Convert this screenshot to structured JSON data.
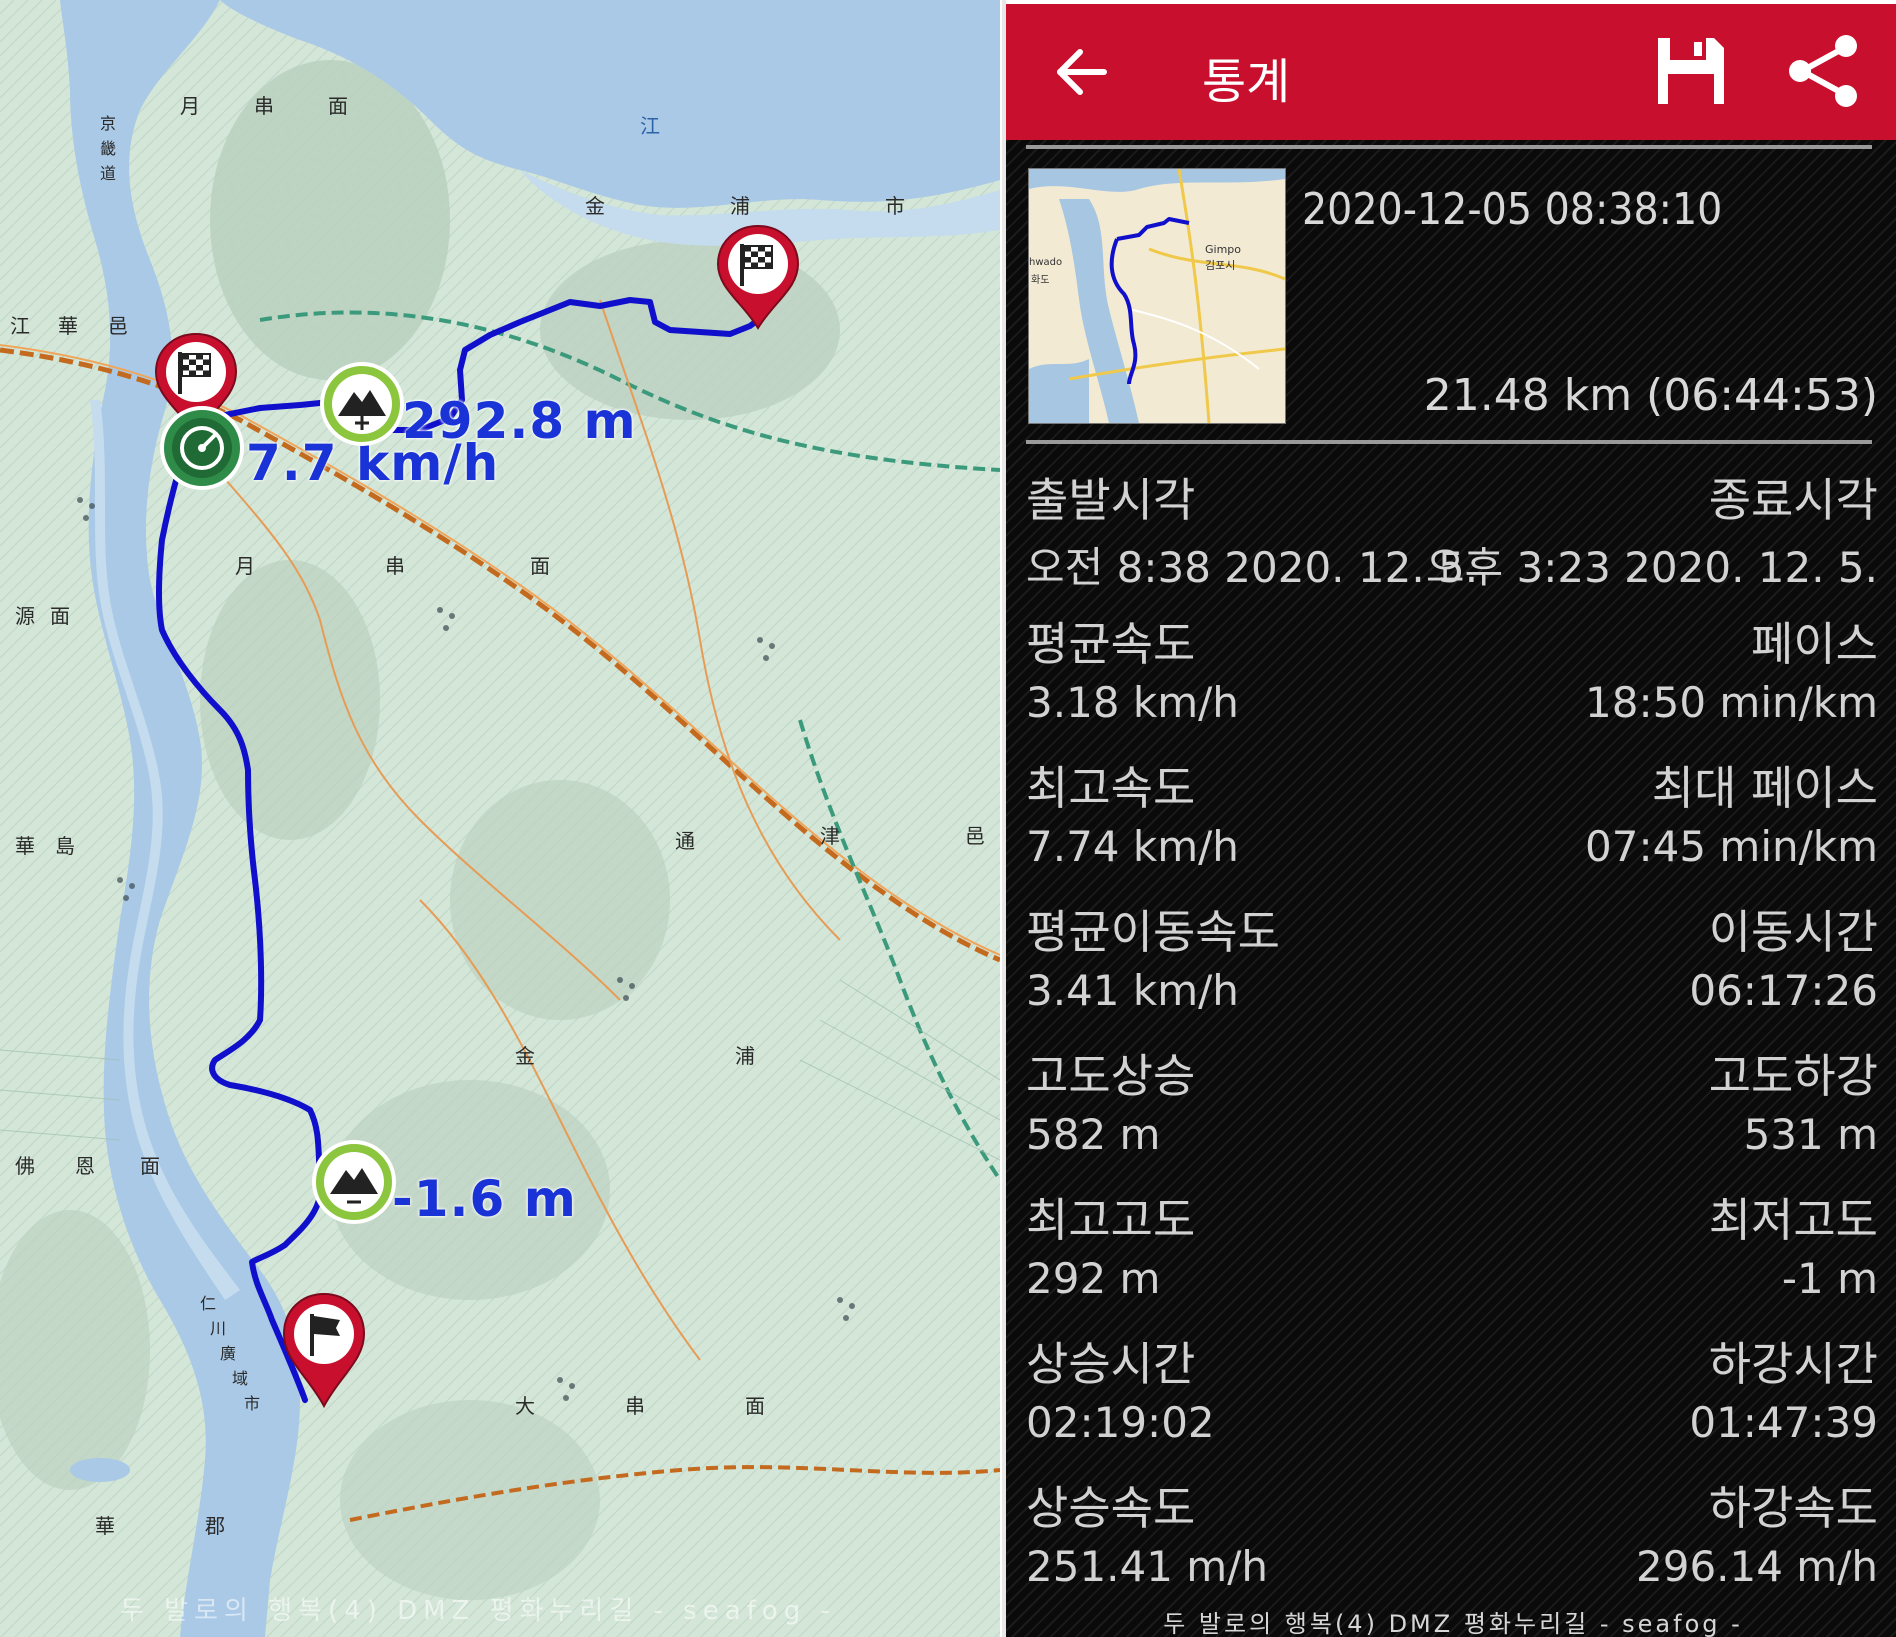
{
  "map": {
    "labels": {
      "elevation_max": "292.8 m",
      "speed_max": "7.7 km/h",
      "elevation_min": "-1.6 m"
    },
    "hanja": [
      "月",
      "串",
      "面",
      "江",
      "金",
      "浦",
      "市",
      "源",
      "面",
      "佛",
      "恩",
      "面",
      "月",
      "串",
      "面",
      "通",
      "津",
      "邑",
      "金",
      "浦",
      "大",
      "串",
      "面",
      "華",
      "郡",
      "華",
      "島",
      "江",
      "華",
      "邑",
      "京",
      "畿",
      "道",
      "仁",
      "川",
      "廣",
      "域",
      "市"
    ],
    "watermark": "두 발로의 행복(4) DMZ 평화누리길 - seafog -",
    "colors": {
      "track": "#1010cc",
      "pin_red": "#c8102e",
      "marker_green": "#7cb82f",
      "marker_dark_green": "#1f7a3a"
    },
    "icons": {
      "start_pin": "checkered-flag-icon",
      "end_pin": "checkered-flag-icon",
      "finish_pin": "flag-icon",
      "max_elevation": "mountain-plus-icon",
      "min_elevation": "mountain-minus-icon",
      "max_speed": "speedometer-icon"
    }
  },
  "panel": {
    "title": "통계",
    "icons": {
      "back": "arrow-left-icon",
      "save": "floppy-disk-icon",
      "share": "share-icon"
    },
    "thumbnail": {
      "labels": [
        "hwado",
        "화도",
        "Gimpo",
        "김포시"
      ]
    },
    "date": "2020-12-05 08:38:10",
    "distance_time": "21.48 km (06:44:53)",
    "stats": [
      {
        "left_label": "출발시각",
        "right_label": "종료시각",
        "left_value": "오전 8:38 2020. 12. 5.",
        "right_value": "오후 3:23 2020. 12. 5."
      },
      {
        "left_label": "평균속도",
        "right_label": "페이스",
        "left_value": "3.18 km/h",
        "right_value": "18:50 min/km"
      },
      {
        "left_label": "최고속도",
        "right_label": "최대 페이스",
        "left_value": "7.74 km/h",
        "right_value": "07:45 min/km"
      },
      {
        "left_label": "평균이동속도",
        "right_label": "이동시간",
        "left_value": "3.41 km/h",
        "right_value": "06:17:26"
      },
      {
        "left_label": "고도상승",
        "right_label": "고도하강",
        "left_value": "582 m",
        "right_value": "531 m"
      },
      {
        "left_label": "최고고도",
        "right_label": "최저고도",
        "left_value": "292 m",
        "right_value": "-1 m"
      },
      {
        "left_label": "상승시간",
        "right_label": "하강시간",
        "left_value": "02:19:02",
        "right_value": "01:47:39"
      },
      {
        "left_label": "상승속도",
        "right_label": "하강속도",
        "left_value": "251.41 m/h",
        "right_value": "296.14 m/h"
      }
    ],
    "watermark": "두 발로의 행복(4) DMZ 평화누리길 - seafog -"
  }
}
